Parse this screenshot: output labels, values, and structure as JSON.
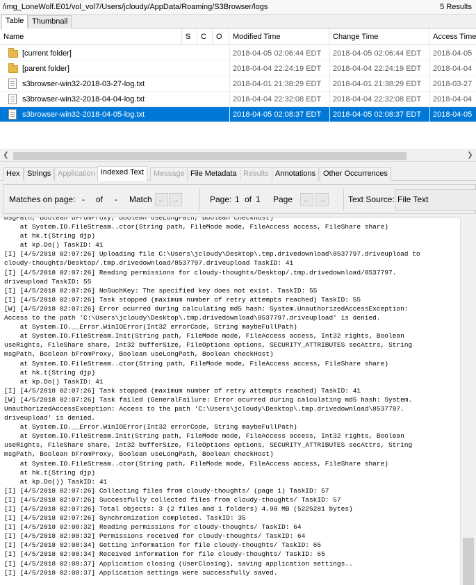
{
  "path_bar": {
    "path": "/img_LoneWolf.E01/vol_vol7/Users/jcloudy/AppData/Roaming/S3Browser/logs",
    "results": "5  Results"
  },
  "view_tabs": [
    "Table",
    "Thumbnail"
  ],
  "table": {
    "columns": [
      "Name",
      "S",
      "C",
      "O",
      "Modified Time",
      "Change Time",
      "Access Time"
    ],
    "rows": [
      {
        "icon": "folder-icon",
        "name": "[current folder]",
        "modified": "2018-04-05 02:06:44 EDT",
        "changed": "2018-04-05 02:06:44 EDT",
        "accessed": "2018-04-05"
      },
      {
        "icon": "folder-icon",
        "name": "[parent folder]",
        "modified": "2018-04-04 22:24:19 EDT",
        "changed": "2018-04-04 22:24:19 EDT",
        "accessed": "2018-04-04"
      },
      {
        "icon": "file-icon",
        "name": "s3browser-win32-2018-03-27-log.txt",
        "modified": "2018-04-01 21:38:29 EDT",
        "changed": "2018-04-01 21:38:29 EDT",
        "accessed": "2018-03-27"
      },
      {
        "icon": "file-icon",
        "name": "s3browser-win32-2018-04-04-log.txt",
        "modified": "2018-04-04 22:32:08 EDT",
        "changed": "2018-04-04 22:32:08 EDT",
        "accessed": "2018-04-04"
      },
      {
        "icon": "file-icon",
        "name": "s3browser-win32-2018-04-05-log.txt",
        "modified": "2018-04-05 02:08:37 EDT",
        "changed": "2018-04-05 02:08:37 EDT",
        "accessed": "2018-04-05",
        "selected": true
      }
    ]
  },
  "content_tabs": [
    {
      "label": "Hex",
      "state": "normal"
    },
    {
      "label": "Strings",
      "state": "normal"
    },
    {
      "label": "Application",
      "state": "disabled"
    },
    {
      "label": "Indexed Text",
      "state": "active"
    },
    {
      "label": "Message",
      "state": "disabled"
    },
    {
      "label": "File Metadata",
      "state": "normal"
    },
    {
      "label": "Results",
      "state": "disabled"
    },
    {
      "label": "Annotations",
      "state": "normal"
    },
    {
      "label": "Other Occurrences",
      "state": "normal"
    }
  ],
  "toolbar": {
    "matches_label": "Matches on page:",
    "matches_current": "-",
    "of1": "of",
    "matches_total": "-",
    "match_label": "Match",
    "page_label": "Page:",
    "page_current": "1",
    "of2": "of",
    "page_total": "1",
    "page_label2": "Page",
    "text_source_label": "Text Source:",
    "text_source_value": "File Text"
  },
  "log_lines": [
    "msgPath, Boolean bFromProxy, Boolean useLongPath, Boolean checkHost)",
    "    at System.IO.FileStream..ctor(String path, FileMode mode, FileAccess access, FileShare share)",
    "    at hk.t(String djp)",
    "    at kp.Do() TaskID: 41",
    "[I] [4/5/2018 02:07:26] Uploading file C:\\Users\\jcloudy\\Desktop\\.tmp.drivedownload\\8537797.driveupload to",
    "cloudy-thoughts/Desktop/.tmp.drivedownload/8537797.driveupload TaskID: 41",
    "[I] [4/5/2018 02:07:26] Reading permissions for cloudy-thoughts/Desktop/.tmp.drivedownload/8537797.",
    "driveupload TaskID: 55",
    "[I] [4/5/2018 02:07:26] NoSuchKey: The specified key does not exist. TaskID: 55",
    "[I] [4/5/2018 02:07:26] Task stopped (maximum number of retry attempts reached) TaskID: 55",
    "[W] [4/5/2018 02:07:26] Error ocurred during calculating md5 hash: System.UnauthorizedAccessException:",
    "Access to the path 'C:\\Users\\jcloudy\\Desktop\\.tmp.drivedownload\\8537797.driveupload' is denied.",
    "    at System.IO.__Error.WinIOError(Int32 errorCode, String maybeFullPath)",
    "    at System.IO.FileStream.Init(String path, FileMode mode, FileAccess access, Int32 rights, Boolean",
    "useRights, FileShare share, Int32 bufferSize, FileOptions options, SECURITY_ATTRIBUTES secAttrs, String",
    "msgPath, Boolean bFromProxy, Boolean useLongPath, Boolean checkHost)",
    "    at System.IO.FileStream..ctor(String path, FileMode mode, FileAccess access, FileShare share)",
    "    at hk.t(String djp)",
    "    at kp.Do() TaskID: 41",
    "[I] [4/5/2018 02:07:26] Task stopped (maximum number of retry attempts reached) TaskID: 41",
    "[W] [4/5/2018 02:07:26] Task failed (GeneralFailure: Error ocurred during calculating md5 hash: System.",
    "UnauthorizedAccessException: Access to the path 'C:\\Users\\jcloudy\\Desktop\\.tmp.drivedownload\\8537797.",
    "driveupload' is denied.",
    "    at System.IO.__Error.WinIOError(Int32 errorCode, String maybeFullPath)",
    "    at System.IO.FileStream.Init(String path, FileMode mode, FileAccess access, Int32 rights, Boolean",
    "useRights, FileShare share, Int32 bufferSize, FileOptions options, SECURITY_ATTRIBUTES secAttrs, String",
    "msgPath, Boolean bFromProxy, Boolean useLongPath, Boolean checkHost)",
    "    at System.IO.FileStream..ctor(String path, FileMode mode, FileAccess access, FileShare share)",
    "    at hk.t(String djp)",
    "    at kp.Do()) TaskID: 41",
    "[I] [4/5/2018 02:07:26] Collecting files from cloudy-thoughts/ (page 1) TaskID: 57",
    "[I] [4/5/2018 02:07:26] Successfully collected files from cloudy-thoughts/ TaskID: 57",
    "[I] [4/5/2018 02:07:26] Total objects: 3 (2 files and 1 folders) 4.98 MB (5225281 bytes)",
    "[I] [4/5/2018 02:07:26] Synchronization completed. TaskID: 35",
    "[I] [4/5/2018 02:08:32] Reading permissions for cloudy-thoughts/ TaskID: 64",
    "[I] [4/5/2018 02:08:32] Permissions received for cloudy-thoughts/ TaskID: 64",
    "[I] [4/5/2018 02:08:34] Getting information for file cloudy-thoughts/ TaskID: 65",
    "[I] [4/5/2018 02:08:34] Received information for file cloudy-thoughts/ TaskID: 65",
    "[I] [4/5/2018 02:08:37] Application closing (UserClosing), saving application settings..",
    "[I] [4/5/2018 02:08:37] Application settings were successfully saved."
  ]
}
